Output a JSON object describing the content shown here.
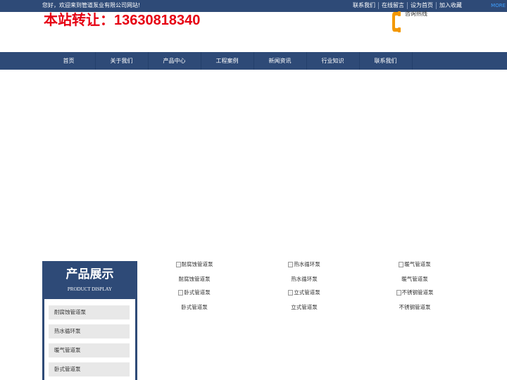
{
  "topbar": {
    "welcome": "您好，欢迎来到管道泵业有限公司网站!",
    "links": [
      "联系我们",
      "在线留言",
      "设为首页",
      "加入收藏"
    ],
    "more": "MORE"
  },
  "header": {
    "hotline_big": "本站转让：13630818340",
    "hotline_label": "咨询热线"
  },
  "nav": {
    "items": [
      "首页",
      "关于我们",
      "产品中心",
      "工程案例",
      "新闻资讯",
      "行业知识",
      "联系我们"
    ]
  },
  "sidebar": {
    "title": "产品展示",
    "subtitle": "PRODUCT DISPLAY",
    "categories": [
      "耐腐蚀管道泵",
      "热水循环泵",
      "暖气管道泵",
      "卧式管道泵"
    ]
  },
  "products": [
    {
      "alt": "耐腐蚀管道泵",
      "name": "耐腐蚀管道泵"
    },
    {
      "alt": "热水循环泵",
      "name": "热水循环泵"
    },
    {
      "alt": "暖气管道泵",
      "name": "暖气管道泵"
    },
    {
      "alt": "卧式管道泵",
      "name": "卧式管道泵"
    },
    {
      "alt": "立式管道泵",
      "name": "立式管道泵"
    },
    {
      "alt": "不锈钢管道泵",
      "name": "不锈钢管道泵"
    }
  ],
  "colors": {
    "primary": "#2e4a77",
    "accent_red": "#e60012",
    "phone_orange": "#f39800"
  },
  "icons": {
    "phone": "phone-icon",
    "broken_image": "broken-image-icon"
  }
}
